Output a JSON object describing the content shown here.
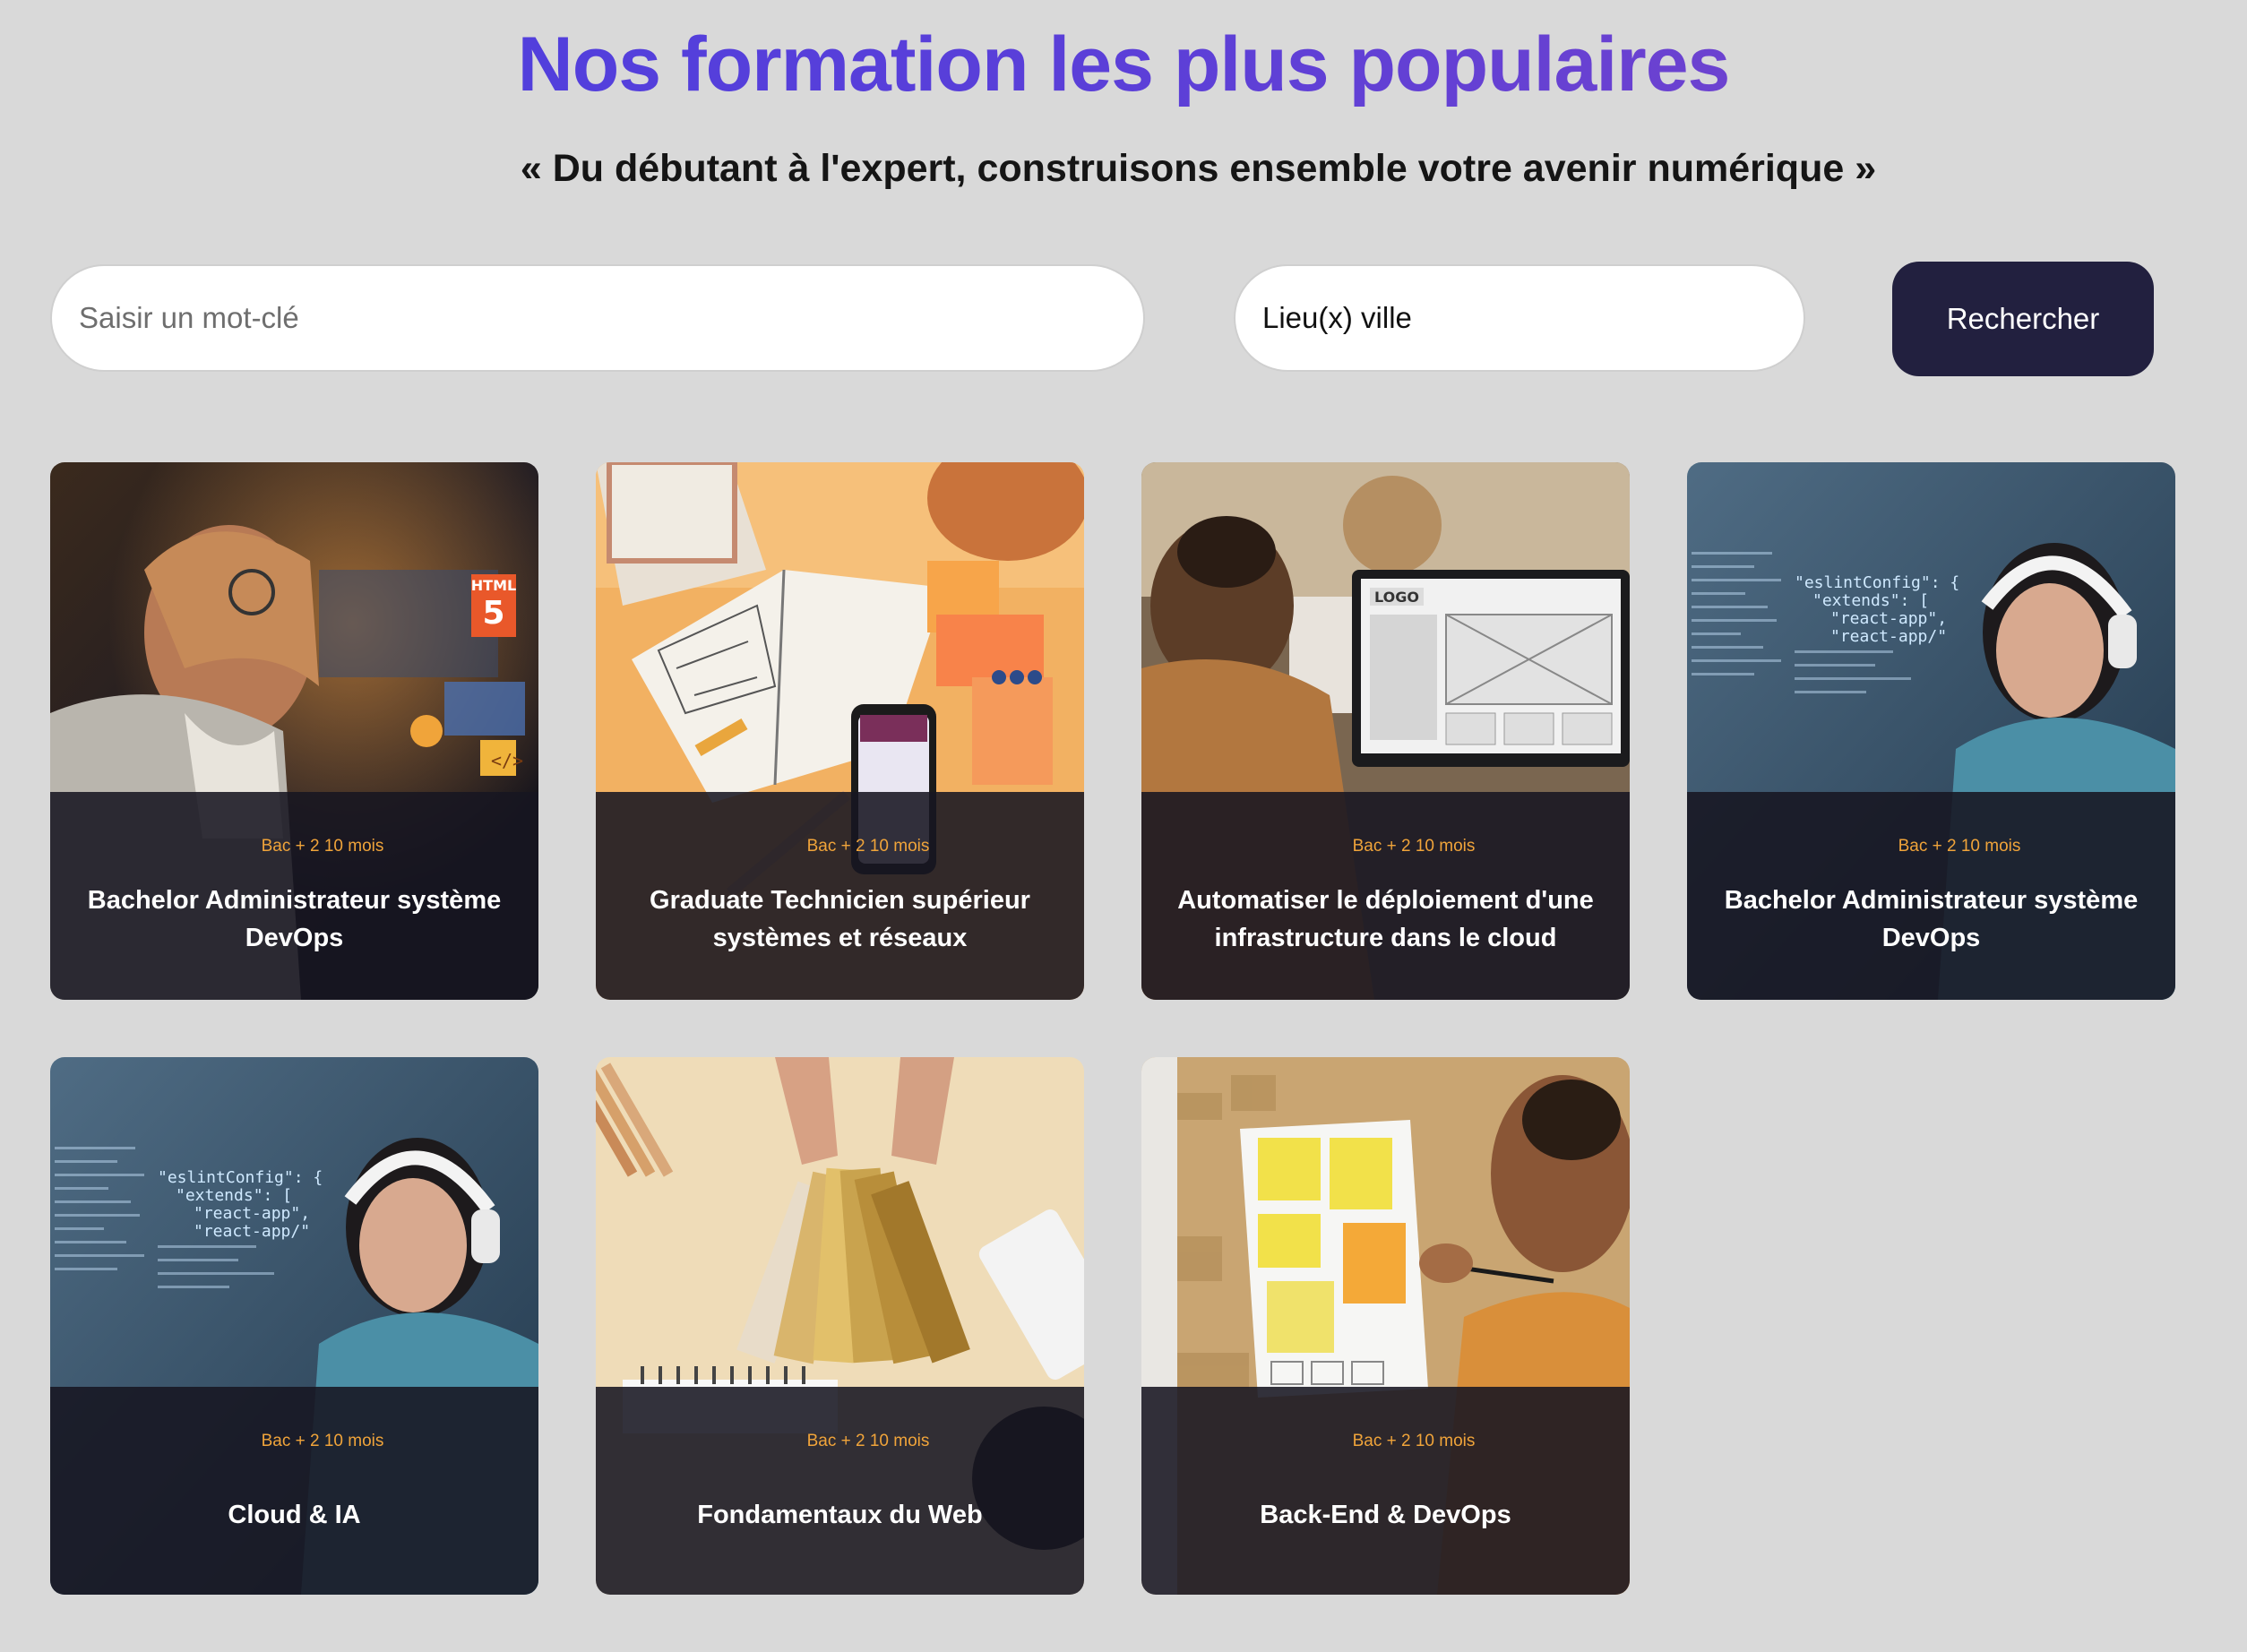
{
  "header": {
    "title": "Nos formation les plus populaires",
    "subtitle": "« Du débutant à l'expert, construisons ensemble votre avenir numérique »"
  },
  "search": {
    "keyword_placeholder": "Saisir un mot-clé",
    "city_placeholder": "Lieu(x) ville",
    "button_label": "Rechercher"
  },
  "courses": [
    {
      "meta": "Bac + 2 10 mois",
      "title": "Bachelor Administrateur système DevOps"
    },
    {
      "meta": "Bac + 2 10 mois",
      "title": "Graduate Technicien supérieur systèmes et réseaux"
    },
    {
      "meta": "Bac + 2 10 mois",
      "title": "Automatiser le déploiement d'une infrastructure dans le cloud"
    },
    {
      "meta": "Bac + 2 10 mois",
      "title": "Bachelor Administrateur système DevOps"
    },
    {
      "meta": "Bac + 2 10 mois",
      "title": "Cloud & IA"
    },
    {
      "meta": "Bac + 2 10 mois",
      "title": "Fondamentaux du Web"
    },
    {
      "meta": "Bac + 2 10 mois",
      "title": "Back-End & DevOps"
    }
  ],
  "image_text": {
    "html5_badge": "HTML",
    "html5_number": "5",
    "code_tag": "</>",
    "monitor_logo": "LOGO",
    "code_snippet": "\"eslintConfig\": {\n  \"extends\": [\n    \"react-app\",\n    \"react-app/\""
  },
  "colors": {
    "background": "#d9d9d9",
    "title_gradient_start": "#4a3fe0",
    "title_gradient_end": "#7a44c9",
    "button_bg": "#22203f",
    "card_meta": "#f0a43a",
    "card_overlay": "#171621"
  }
}
